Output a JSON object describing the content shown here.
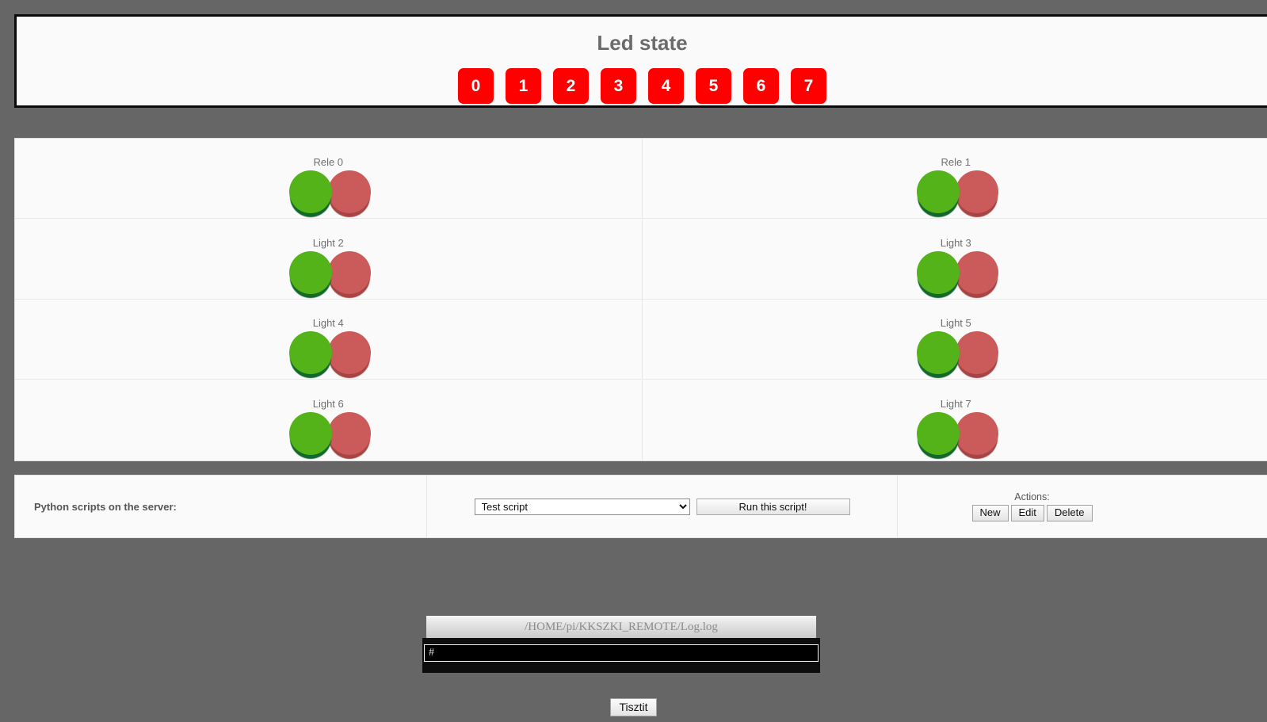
{
  "led_panel": {
    "title": "Led state",
    "buttons": [
      {
        "label": "0",
        "state": "on",
        "color": "#ff0000"
      },
      {
        "label": "1",
        "state": "on",
        "color": "#ff0000"
      },
      {
        "label": "2",
        "state": "on",
        "color": "#ff0000"
      },
      {
        "label": "3",
        "state": "on",
        "color": "#ff0000"
      },
      {
        "label": "4",
        "state": "on",
        "color": "#ff0000"
      },
      {
        "label": "5",
        "state": "on",
        "color": "#ff0000"
      },
      {
        "label": "6",
        "state": "on",
        "color": "#ff0000"
      },
      {
        "label": "7",
        "state": "on",
        "color": "#ff0000"
      }
    ]
  },
  "relays": {
    "green_color": "#53b318",
    "red_color": "#cb5a5a",
    "items": [
      {
        "label": "Rele 0"
      },
      {
        "label": "Rele 1"
      },
      {
        "label": "Light 2"
      },
      {
        "label": "Light 3"
      },
      {
        "label": "Light 4"
      },
      {
        "label": "Light 5"
      },
      {
        "label": "Light 6"
      },
      {
        "label": "Light 7"
      }
    ]
  },
  "scripts": {
    "label": "Python scripts on the server:",
    "selected_script": "Test script",
    "script_options": [
      "Test script"
    ],
    "run_button": "Run this script!",
    "actions_label": "Actions:",
    "action_buttons": [
      "New",
      "Edit",
      "Delete"
    ]
  },
  "log": {
    "path": "/HOME/pi/KKSZKI_REMOTE/Log.log",
    "lines": [
      "#"
    ],
    "clear_button": "Tisztit"
  }
}
